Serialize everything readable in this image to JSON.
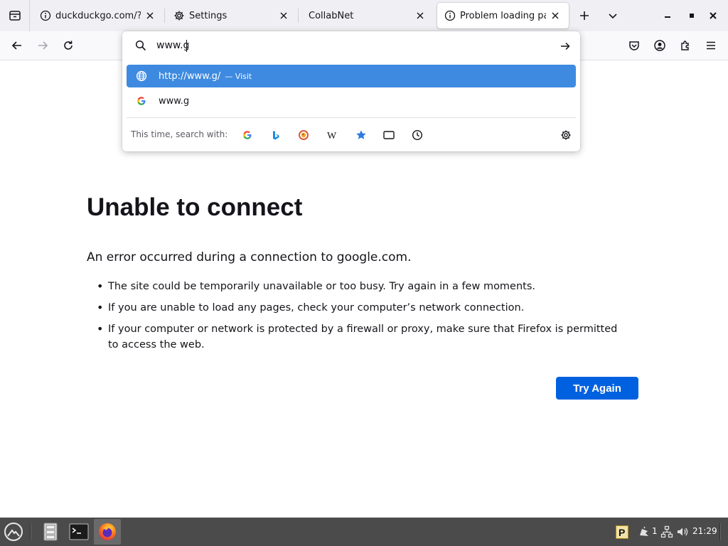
{
  "tabs": [
    {
      "title": "duckduckgo.com/?t=ft",
      "icon": "info-circle-icon",
      "selected": false
    },
    {
      "title": "Settings",
      "icon": "gear-icon",
      "selected": false
    },
    {
      "title": "CollabNet",
      "icon": "",
      "selected": false
    },
    {
      "title": "Problem loading page",
      "icon": "info-circle-icon",
      "selected": true
    }
  ],
  "urlbar": {
    "value": "www.g",
    "results": [
      {
        "title": "http://www.g/",
        "action": "— Visit",
        "icon": "globe-icon",
        "selected": true
      },
      {
        "title": "www.g",
        "action": "",
        "icon": "google-icon",
        "selected": false
      }
    ],
    "search_with_label": "This time, search with:",
    "engines": [
      "google-icon",
      "bing-icon",
      "duckduckgo-icon",
      "wikipedia-icon",
      "bookmarks-star-icon",
      "tabs-icon",
      "history-clock-icon"
    ]
  },
  "error": {
    "title": "Unable to connect",
    "intro": "An error occurred during a connection to google.com.",
    "bullets": [
      "The site could be temporarily unavailable or too busy. Try again in a few moments.",
      "If you are unable to load any pages, check your computer’s network connection.",
      "If your computer or network is protected by a firewall or proxy, make sure that Firefox is permitted to access the web."
    ],
    "button_label": "Try Again"
  },
  "taskbar": {
    "workspace_number": "1",
    "clock": "21:29"
  },
  "colors": {
    "accent": "#0061e0",
    "selection": "#3e8ae0",
    "taskbar": "#4b4b4b"
  }
}
